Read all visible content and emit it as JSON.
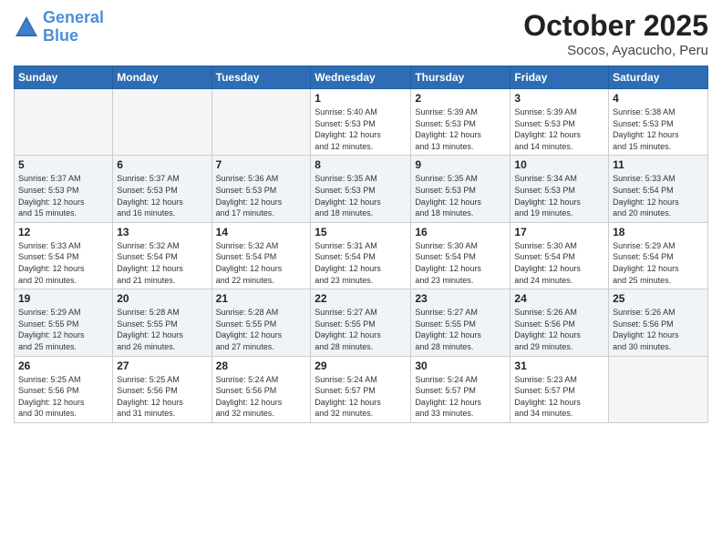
{
  "logo": {
    "line1": "General",
    "line2": "Blue"
  },
  "title": "October 2025",
  "subtitle": "Socos, Ayacucho, Peru",
  "weekdays": [
    "Sunday",
    "Monday",
    "Tuesday",
    "Wednesday",
    "Thursday",
    "Friday",
    "Saturday"
  ],
  "weeks": [
    [
      {
        "day": "",
        "info": ""
      },
      {
        "day": "",
        "info": ""
      },
      {
        "day": "",
        "info": ""
      },
      {
        "day": "1",
        "info": "Sunrise: 5:40 AM\nSunset: 5:53 PM\nDaylight: 12 hours\nand 12 minutes."
      },
      {
        "day": "2",
        "info": "Sunrise: 5:39 AM\nSunset: 5:53 PM\nDaylight: 12 hours\nand 13 minutes."
      },
      {
        "day": "3",
        "info": "Sunrise: 5:39 AM\nSunset: 5:53 PM\nDaylight: 12 hours\nand 14 minutes."
      },
      {
        "day": "4",
        "info": "Sunrise: 5:38 AM\nSunset: 5:53 PM\nDaylight: 12 hours\nand 15 minutes."
      }
    ],
    [
      {
        "day": "5",
        "info": "Sunrise: 5:37 AM\nSunset: 5:53 PM\nDaylight: 12 hours\nand 15 minutes."
      },
      {
        "day": "6",
        "info": "Sunrise: 5:37 AM\nSunset: 5:53 PM\nDaylight: 12 hours\nand 16 minutes."
      },
      {
        "day": "7",
        "info": "Sunrise: 5:36 AM\nSunset: 5:53 PM\nDaylight: 12 hours\nand 17 minutes."
      },
      {
        "day": "8",
        "info": "Sunrise: 5:35 AM\nSunset: 5:53 PM\nDaylight: 12 hours\nand 18 minutes."
      },
      {
        "day": "9",
        "info": "Sunrise: 5:35 AM\nSunset: 5:53 PM\nDaylight: 12 hours\nand 18 minutes."
      },
      {
        "day": "10",
        "info": "Sunrise: 5:34 AM\nSunset: 5:53 PM\nDaylight: 12 hours\nand 19 minutes."
      },
      {
        "day": "11",
        "info": "Sunrise: 5:33 AM\nSunset: 5:54 PM\nDaylight: 12 hours\nand 20 minutes."
      }
    ],
    [
      {
        "day": "12",
        "info": "Sunrise: 5:33 AM\nSunset: 5:54 PM\nDaylight: 12 hours\nand 20 minutes."
      },
      {
        "day": "13",
        "info": "Sunrise: 5:32 AM\nSunset: 5:54 PM\nDaylight: 12 hours\nand 21 minutes."
      },
      {
        "day": "14",
        "info": "Sunrise: 5:32 AM\nSunset: 5:54 PM\nDaylight: 12 hours\nand 22 minutes."
      },
      {
        "day": "15",
        "info": "Sunrise: 5:31 AM\nSunset: 5:54 PM\nDaylight: 12 hours\nand 23 minutes."
      },
      {
        "day": "16",
        "info": "Sunrise: 5:30 AM\nSunset: 5:54 PM\nDaylight: 12 hours\nand 23 minutes."
      },
      {
        "day": "17",
        "info": "Sunrise: 5:30 AM\nSunset: 5:54 PM\nDaylight: 12 hours\nand 24 minutes."
      },
      {
        "day": "18",
        "info": "Sunrise: 5:29 AM\nSunset: 5:54 PM\nDaylight: 12 hours\nand 25 minutes."
      }
    ],
    [
      {
        "day": "19",
        "info": "Sunrise: 5:29 AM\nSunset: 5:55 PM\nDaylight: 12 hours\nand 25 minutes."
      },
      {
        "day": "20",
        "info": "Sunrise: 5:28 AM\nSunset: 5:55 PM\nDaylight: 12 hours\nand 26 minutes."
      },
      {
        "day": "21",
        "info": "Sunrise: 5:28 AM\nSunset: 5:55 PM\nDaylight: 12 hours\nand 27 minutes."
      },
      {
        "day": "22",
        "info": "Sunrise: 5:27 AM\nSunset: 5:55 PM\nDaylight: 12 hours\nand 28 minutes."
      },
      {
        "day": "23",
        "info": "Sunrise: 5:27 AM\nSunset: 5:55 PM\nDaylight: 12 hours\nand 28 minutes."
      },
      {
        "day": "24",
        "info": "Sunrise: 5:26 AM\nSunset: 5:56 PM\nDaylight: 12 hours\nand 29 minutes."
      },
      {
        "day": "25",
        "info": "Sunrise: 5:26 AM\nSunset: 5:56 PM\nDaylight: 12 hours\nand 30 minutes."
      }
    ],
    [
      {
        "day": "26",
        "info": "Sunrise: 5:25 AM\nSunset: 5:56 PM\nDaylight: 12 hours\nand 30 minutes."
      },
      {
        "day": "27",
        "info": "Sunrise: 5:25 AM\nSunset: 5:56 PM\nDaylight: 12 hours\nand 31 minutes."
      },
      {
        "day": "28",
        "info": "Sunrise: 5:24 AM\nSunset: 5:56 PM\nDaylight: 12 hours\nand 32 minutes."
      },
      {
        "day": "29",
        "info": "Sunrise: 5:24 AM\nSunset: 5:57 PM\nDaylight: 12 hours\nand 32 minutes."
      },
      {
        "day": "30",
        "info": "Sunrise: 5:24 AM\nSunset: 5:57 PM\nDaylight: 12 hours\nand 33 minutes."
      },
      {
        "day": "31",
        "info": "Sunrise: 5:23 AM\nSunset: 5:57 PM\nDaylight: 12 hours\nand 34 minutes."
      },
      {
        "day": "",
        "info": ""
      }
    ]
  ]
}
